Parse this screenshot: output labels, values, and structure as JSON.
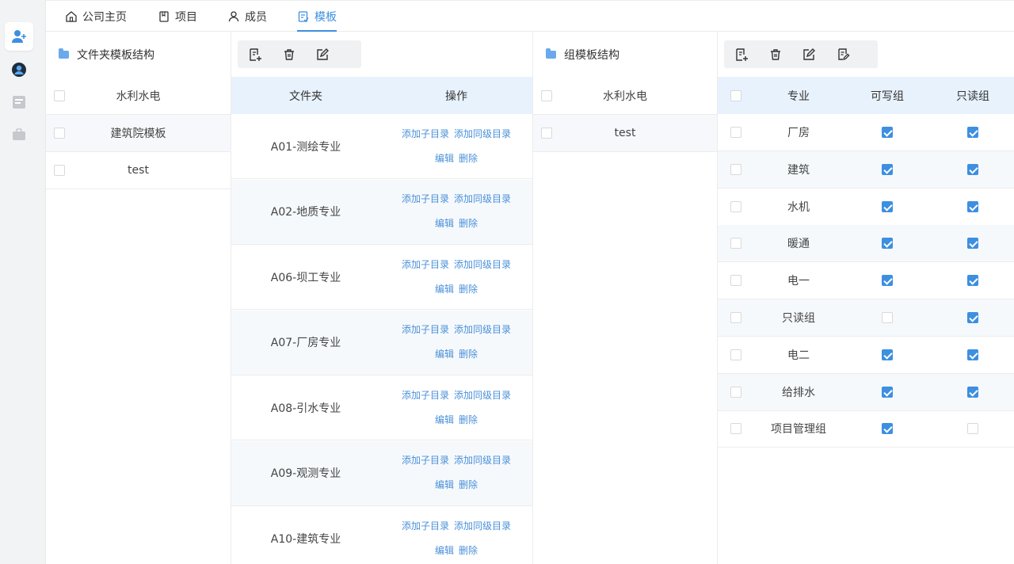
{
  "nav": {
    "tabs": [
      {
        "label": "公司主页",
        "icon": "home-icon"
      },
      {
        "label": "项目",
        "icon": "book-icon"
      },
      {
        "label": "成员",
        "icon": "user-icon"
      },
      {
        "label": "模板",
        "icon": "template-icon"
      }
    ],
    "active_tab": "模板"
  },
  "folder_tree": {
    "title": "文件夹模板结构",
    "items": [
      "水利水电",
      "建筑院模板",
      "test"
    ]
  },
  "folder_table": {
    "headers": [
      "文件夹",
      "操作"
    ],
    "actions": {
      "add_child": "添加子目录",
      "add_sibling": "添加同级目录",
      "edit": "编辑",
      "delete": "删除"
    },
    "rows": [
      "A01-测绘专业",
      "A02-地质专业",
      "A06-坝工专业",
      "A07-厂房专业",
      "A08-引水专业",
      "A09-观测专业",
      "A10-建筑专业"
    ]
  },
  "group_tree": {
    "title": "组模板结构",
    "items": [
      "水利水电",
      "test"
    ]
  },
  "group_table": {
    "headers": [
      "专业",
      "可写组",
      "只读组"
    ],
    "rows": [
      {
        "name": "厂房",
        "writable": true,
        "readonly": true
      },
      {
        "name": "建筑",
        "writable": true,
        "readonly": true
      },
      {
        "name": "水机",
        "writable": true,
        "readonly": true
      },
      {
        "name": "暖通",
        "writable": true,
        "readonly": true
      },
      {
        "name": "电一",
        "writable": true,
        "readonly": true
      },
      {
        "name": "只读组",
        "writable": false,
        "readonly": true
      },
      {
        "name": "电二",
        "writable": true,
        "readonly": true
      },
      {
        "name": "给排水",
        "writable": true,
        "readonly": true
      },
      {
        "name": "项目管理组",
        "writable": true,
        "readonly": false
      }
    ]
  },
  "colors": {
    "accent": "#3d8fe0",
    "header_bg": "#e8f2fd",
    "rail_bg": "#f2f3f5"
  }
}
